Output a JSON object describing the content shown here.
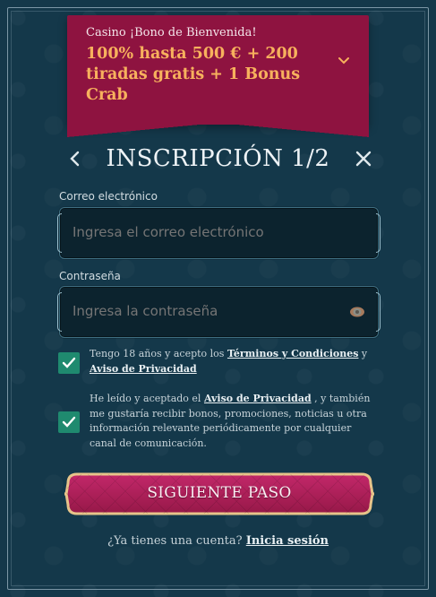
{
  "banner": {
    "subtitle": "Casino ¡Bono de Bienvenida!",
    "title": "100% hasta 500 € + 200 tiradas gratis + 1 Bonus Crab",
    "icon": "chevron-down-icon",
    "title_color": "#f7b15d",
    "background_color": "#8e1340"
  },
  "header": {
    "title": "INSCRIPCIÓN 1/2",
    "back_icon": "chevron-left-icon",
    "close_icon": "close-icon"
  },
  "form": {
    "email": {
      "label": "Correo electrónico",
      "placeholder": "Ingresa el correo electrónico",
      "value": ""
    },
    "password": {
      "label": "Contraseña",
      "placeholder": "Ingresa la contraseña",
      "value": "",
      "icon": "eye-icon"
    },
    "terms": {
      "checked": true,
      "text_before": "Tengo 18 años y acepto los ",
      "link_terms": "Términos y Condiciones",
      "text_middle": " y",
      "link_privacy": "Aviso de Privacidad"
    },
    "marketing": {
      "checked": true,
      "text_before": "He leído y aceptado el ",
      "link_privacy": "Aviso de Privacidad",
      "text_after": " , y también me gustaría recibir bonos, promociones, noticias u otra información relevante periódicamente por cualquier canal de comunicación."
    },
    "submit_label": "SIGUIENTE PASO"
  },
  "footer": {
    "question": "¿Ya tienes una cuenta? ",
    "login_link": "Inicia sesión"
  },
  "colors": {
    "page_background": "#143646",
    "checkbox": "#1f8a6f",
    "button": "#b21d5a",
    "button_border": "#e7c48a"
  }
}
